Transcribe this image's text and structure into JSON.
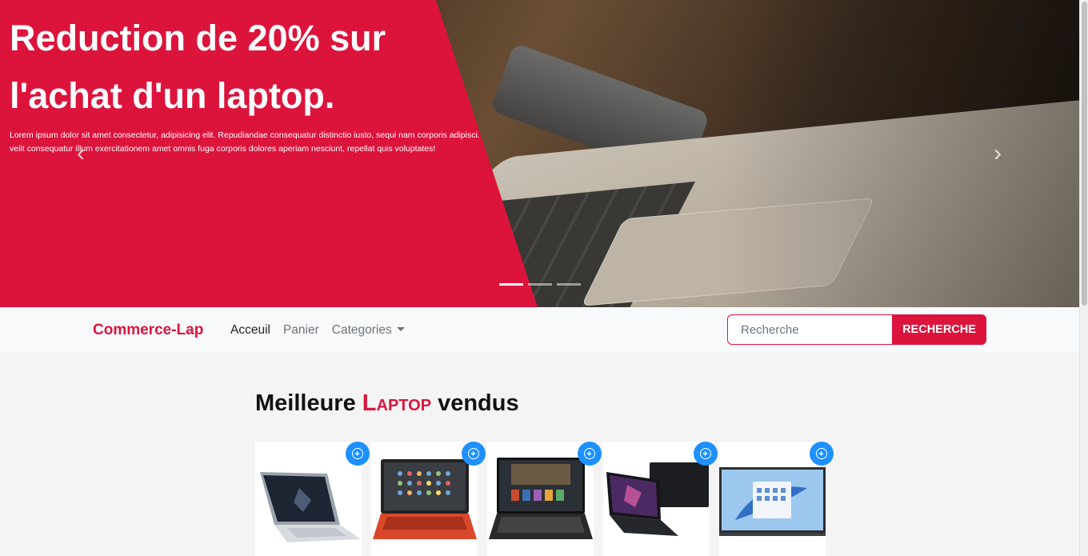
{
  "hero": {
    "title": "Reduction de 20% sur l'achat d'un laptop.",
    "text": "Lorem ipsum dolor sit amet consectetur, adipisicing elit. Repudiandae consequatur distinctio iusto, sequi nam corporis adipisci. velit consequatur illum exercitationem amet omnis fuga corporis dolores aperiam nesciunt, repellat quis voluptates!",
    "prev_icon": "chevron-left-icon",
    "next_icon": "chevron-right-icon",
    "prev_glyph": "‹",
    "next_glyph": "›",
    "active_slide": 1,
    "slide_count": 3,
    "accent_color": "#dc143c"
  },
  "navbar": {
    "brand": "Commerce-Lap",
    "links": [
      {
        "label": "Acceuil"
      },
      {
        "label": "Panier"
      },
      {
        "label": "Categories"
      }
    ],
    "search": {
      "placeholder": "Recherche",
      "value": "",
      "button_label": "RECHERCHE"
    }
  },
  "section": {
    "title_before": "Meilleure ",
    "title_accent": "Laptop",
    "title_after": " vendus"
  },
  "products": {
    "add_icon": "plus-circle-icon",
    "add_color": "#1e90ff",
    "items": [
      {
        "image": "silver-laptop"
      },
      {
        "image": "red-chromebook"
      },
      {
        "image": "gaming-laptop"
      },
      {
        "image": "dual-screen-laptop"
      },
      {
        "image": "windows-laptop"
      }
    ]
  }
}
